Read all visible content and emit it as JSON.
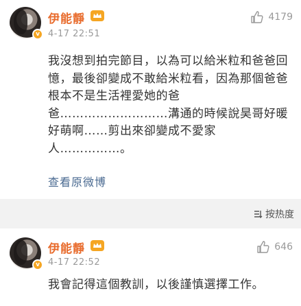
{
  "post": {
    "username": "伊能靜",
    "verified_badge": "v",
    "crown_icon": "crown-icon",
    "timestamp": "4-17 22:51",
    "like_count": "4179",
    "text": "我沒想到拍完節目，以為可以給米粒和爸爸回憶，最後卻變成不敢給米粒看，因為那個爸爸根本不是生活裡愛她的爸爸………………………溝通的時候說昊哥好暖好萌啊……剪出來卻變成不愛家人……………。",
    "view_original": "查看原微博"
  },
  "sort": {
    "label": "按热度",
    "icon": "sort-icon"
  },
  "comment": {
    "username": "伊能靜",
    "verified_badge": "v",
    "timestamp": "4-17 22:52",
    "like_count": "646",
    "text": "我會記得這個教訓，以後謹慎選擇工作。"
  },
  "colors": {
    "username": "#e86b2c",
    "link": "#4a6a91",
    "muted": "#999999",
    "band": "#f2f2f2",
    "badge": "#f5a623"
  }
}
